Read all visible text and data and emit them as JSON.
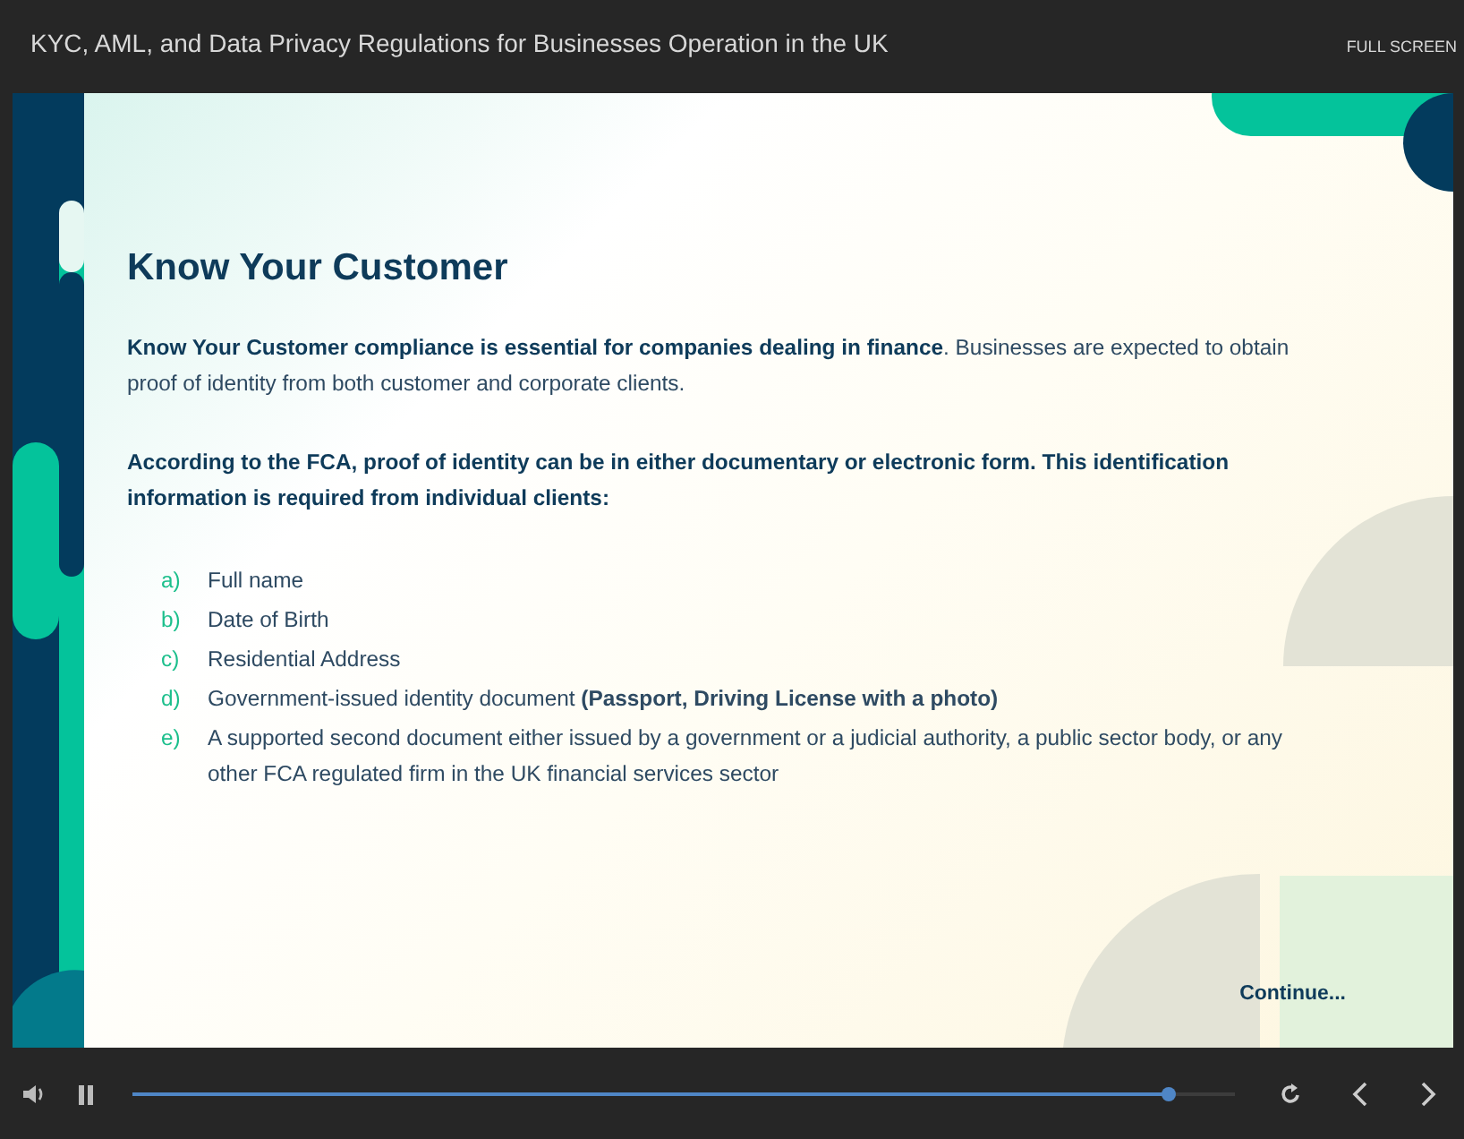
{
  "header": {
    "title": "KYC, AML, and Data Privacy Regulations for Businesses Operation in the UK",
    "fullscreen": "FULL SCREEN"
  },
  "slide": {
    "heading": "Know Your Customer",
    "intro": "**Know Your Customer compliance is essential for companies dealing in finance**. Businesses are expected to obtain proof of identity from both customer and corporate clients.",
    "lead": "According to the FCA, proof of identity can be in either documentary or electronic form. This identification information is required from individual clients:",
    "items": [
      {
        "marker": "a)",
        "text": "Full name"
      },
      {
        "marker": "b)",
        "text": "Date of Birth"
      },
      {
        "marker": "c)",
        "text": "Residential Address"
      },
      {
        "marker": "d)",
        "text": "Government-issued identity document **(Passport, Driving License with a photo)**"
      },
      {
        "marker": "e)",
        "text": "A supported second document either issued by a government or a judicial authority, a public sector body, or any other FCA regulated firm in the UK financial services sector"
      }
    ],
    "continue": "Continue..."
  },
  "player": {
    "progress": {
      "level": 0.94
    }
  }
}
